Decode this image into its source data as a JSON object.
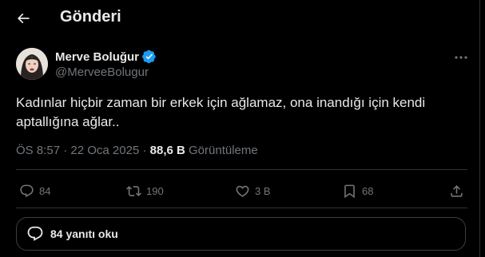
{
  "header": {
    "title": "Gönderi",
    "back_icon": "arrow-left-icon"
  },
  "author": {
    "name": "Merve Boluğur",
    "handle": "@MerveeBolugur",
    "verified": true,
    "verified_color": "#1d9bf0"
  },
  "post": {
    "text": "Kadınlar hiçbir zaman bir erkek için ağlamaz, ona inandığı için kendi aptallığına ağlar..",
    "time": "ÖS 8:57",
    "date": "22 Oca 2025",
    "separator": "·",
    "views_count": "88,6 B",
    "views_label": "Görüntüleme"
  },
  "actions": {
    "replies": "84",
    "reposts": "190",
    "likes": "3 B",
    "bookmarks": "68"
  },
  "replies_button": {
    "label": "84 yanıtı oku"
  }
}
